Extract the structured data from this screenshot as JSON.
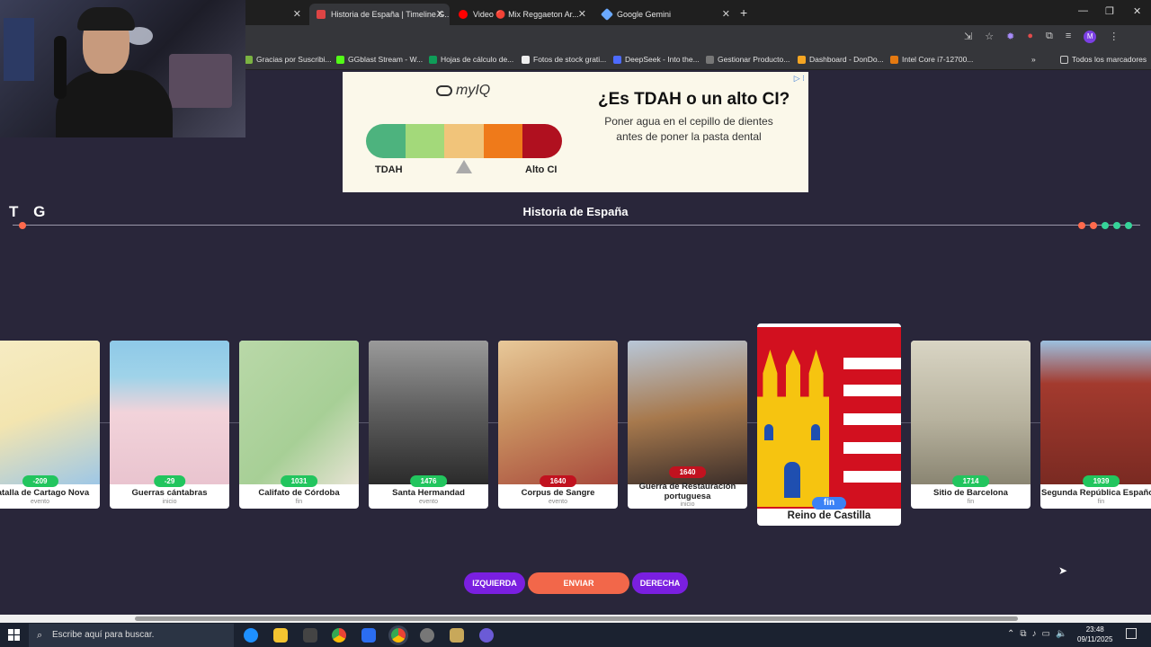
{
  "browser": {
    "tabs": [
      {
        "title": "Historia de España | Timeline.G..."
      },
      {
        "title": "Video 🔴 Mix Reggaeton Ar..."
      },
      {
        "title": "Google Gemini"
      }
    ],
    "new_tab": "+",
    "bookmarks": [
      "Gracias por Suscribi...",
      "GGblast Stream - W...",
      "Hojas de cálculo de...",
      "Fotos de stock grati...",
      "DeepSeek - Into the...",
      "Gestionar Producto...",
      "Dashboard - DonDo...",
      "Intel Core i7-12700...",
      "Todos los marcadores"
    ],
    "more_bookmarks": "»",
    "profile_initial": "M"
  },
  "ad": {
    "brand": "myIQ",
    "left_label": "TDAH",
    "right_label": "Alto CI",
    "headline": "¿Es TDAH o un alto CI?",
    "subtext": "Poner agua en el cepillo de dientes antes de poner la pasta dental",
    "meter_colors": [
      "#4db37e",
      "#a3d97a",
      "#f1c47a",
      "#ef7a1a",
      "#b0101f"
    ]
  },
  "game": {
    "logo": "T G",
    "title": "Historia de España",
    "lives_colors": [
      "#ff6a4d",
      "#ff6a4d",
      "#36d399",
      "#36d399",
      "#36d399"
    ]
  },
  "cards": [
    {
      "year": "-209",
      "name": "Batalla de Cartago Nova",
      "kind": "evento"
    },
    {
      "year": "-29",
      "name": "Guerras cántabras",
      "kind": "inicio"
    },
    {
      "year": "1031",
      "name": "Califato de Córdoba",
      "kind": "fin"
    },
    {
      "year": "1476",
      "name": "Santa Hermandad",
      "kind": "evento"
    },
    {
      "year": "1640",
      "name": "Corpus de Sangre",
      "kind": "evento"
    },
    {
      "year": "1640",
      "name": "Guerra de Restauración portuguesa",
      "kind": "inicio"
    },
    {
      "year": "1714",
      "name": "Sitio de Barcelona",
      "kind": "fin"
    },
    {
      "year": "1939",
      "name": "Segunda República Española",
      "kind": "fin"
    }
  ],
  "active_card": {
    "kind": "fin",
    "name": "Reino de Castilla"
  },
  "buttons": {
    "left": "IZQUIERDA",
    "send": "ENVIAR",
    "right": "DERECHA"
  },
  "taskbar": {
    "search_placeholder": "Escribe aquí para buscar.",
    "time": "23:48",
    "date": "09/11/2025"
  }
}
